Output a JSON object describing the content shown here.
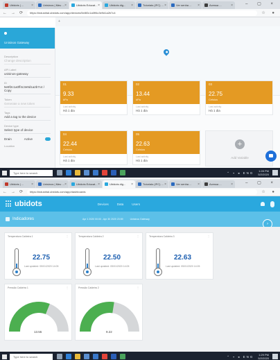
{
  "win1": {
    "tabs": [
      {
        "label": "Ubidots | ...",
        "color": "#c0392b",
        "active": false
      },
      {
        "label": "Unisinos | Meu ...",
        "color": "#2c6bbf",
        "active": false
      },
      {
        "label": "Ubidots Educat...",
        "color": "#2aa8de",
        "active": true
      },
      {
        "label": "Ubidots dig...",
        "color": "#2aa8de",
        "active": false
      },
      {
        "label": "Tutoriais (IFC) ...",
        "color": "#2c6bbf",
        "active": false
      },
      {
        "label": "Ver senha ...",
        "color": "#2c6bbf",
        "active": false
      },
      {
        "label": "Acessa ...",
        "color": "#3d3d3d",
        "active": false
      }
    ],
    "url": "https://industrial.ubidots.com/app/devices/5e8f2c1a0ff4c3e9d1a2b7c4",
    "sidebar": {
      "title": "Unisinos Gateway",
      "fields": [
        {
          "label": "Description",
          "value": "Change description",
          "muted": true
        },
        {
          "label": "API Label",
          "value": "unisinos-gateway",
          "muted": false
        },
        {
          "label": "ID",
          "value": "5e8f2c1a0ff4c3e9d1a2b7c4 / Copy",
          "muted": false
        },
        {
          "label": "Token",
          "value": "Generate a new token",
          "muted": true
        },
        {
          "label": "Tags",
          "value": "Add a tag to the device",
          "muted": false
        },
        {
          "label": "Device type",
          "value": "Select type of device",
          "muted": false
        }
      ],
      "toggle_label": "Drain",
      "toggle2_label": "Active",
      "footer": "Location"
    },
    "map_tool": "+",
    "cards": [
      {
        "num": "01",
        "value": "9.33",
        "unit": "kPa",
        "lbl1": "Last activity",
        "lbl2": "Há 1 dia"
      },
      {
        "num": "02",
        "value": "13.44",
        "unit": "kPa",
        "lbl1": "Last activity",
        "lbl2": "Há 1 dia"
      },
      {
        "num": "03",
        "value": "22.75",
        "unit": "Celsius",
        "lbl1": "Last activity",
        "lbl2": "Há 1 dia"
      },
      {
        "num": "04",
        "value": "22.44",
        "unit": "Celsius",
        "lbl1": "Last activity",
        "lbl2": "Há 1 dia"
      },
      {
        "num": "05",
        "value": "22.63",
        "unit": "Celsius",
        "lbl1": "Last activity",
        "lbl2": "Há 1 dia"
      }
    ],
    "add_card": "Add Variable",
    "taskbar_search": "Type here to search",
    "tray_time": "1:28 PM",
    "tray_date": "5/2/2020"
  },
  "win2": {
    "tabs": [
      {
        "label": "Ubidots | ...",
        "color": "#c0392b",
        "active": false
      },
      {
        "label": "Unisinos | Meu ...",
        "color": "#2c6bbf",
        "active": false
      },
      {
        "label": "Ubidots Educat...",
        "color": "#2aa8de",
        "active": false
      },
      {
        "label": "Ubidots dig...",
        "color": "#2aa8de",
        "active": true
      },
      {
        "label": "Tutoriais (IFC) ...",
        "color": "#2c6bbf",
        "active": false
      },
      {
        "label": "Ver senha ...",
        "color": "#2c6bbf",
        "active": false
      },
      {
        "label": "Acessa ...",
        "color": "#3d3d3d",
        "active": false
      }
    ],
    "url": "https://industrial.ubidots.com/app/dashboards",
    "logo": "ubidots",
    "nav": [
      "Devices",
      "Data",
      "Users"
    ],
    "dashboard_name": "Indicadores",
    "range": "Apr 1 2020 00:00 - Apr 30 2020 23:59",
    "context": "Unisinos Gateway",
    "widgets_thermo": [
      {
        "title": "Temperatura Caldeira 1",
        "value": "22.75",
        "updated": "Last updated: 05/01/2020 14:05",
        "fill": 0.45
      },
      {
        "title": "Temperatura Caldeira 2",
        "value": "22.50",
        "updated": "Last updated: 05/01/2020 14:05",
        "fill": 0.45
      },
      {
        "title": "Temperatura Caldeira 3",
        "value": "22.63",
        "updated": "Last updated: 05/01/2020 14:05",
        "fill": 0.45
      }
    ],
    "widgets_gauge": [
      {
        "title": "Pressão Caldeira 1",
        "value": "13.55",
        "fraction": 0.62
      },
      {
        "title": "Pressão Caldeira 2",
        "value": "9.22",
        "fraction": 0.55
      }
    ],
    "taskbar_search": "Type here to search",
    "tray_time": "1:29 PM",
    "tray_date": "5/2/2020"
  },
  "colors": {
    "ubidots_blue": "#2aa8de",
    "card_orange": "#e49a23",
    "gauge_green": "#4caf50",
    "taskbar": "#1b2230"
  }
}
